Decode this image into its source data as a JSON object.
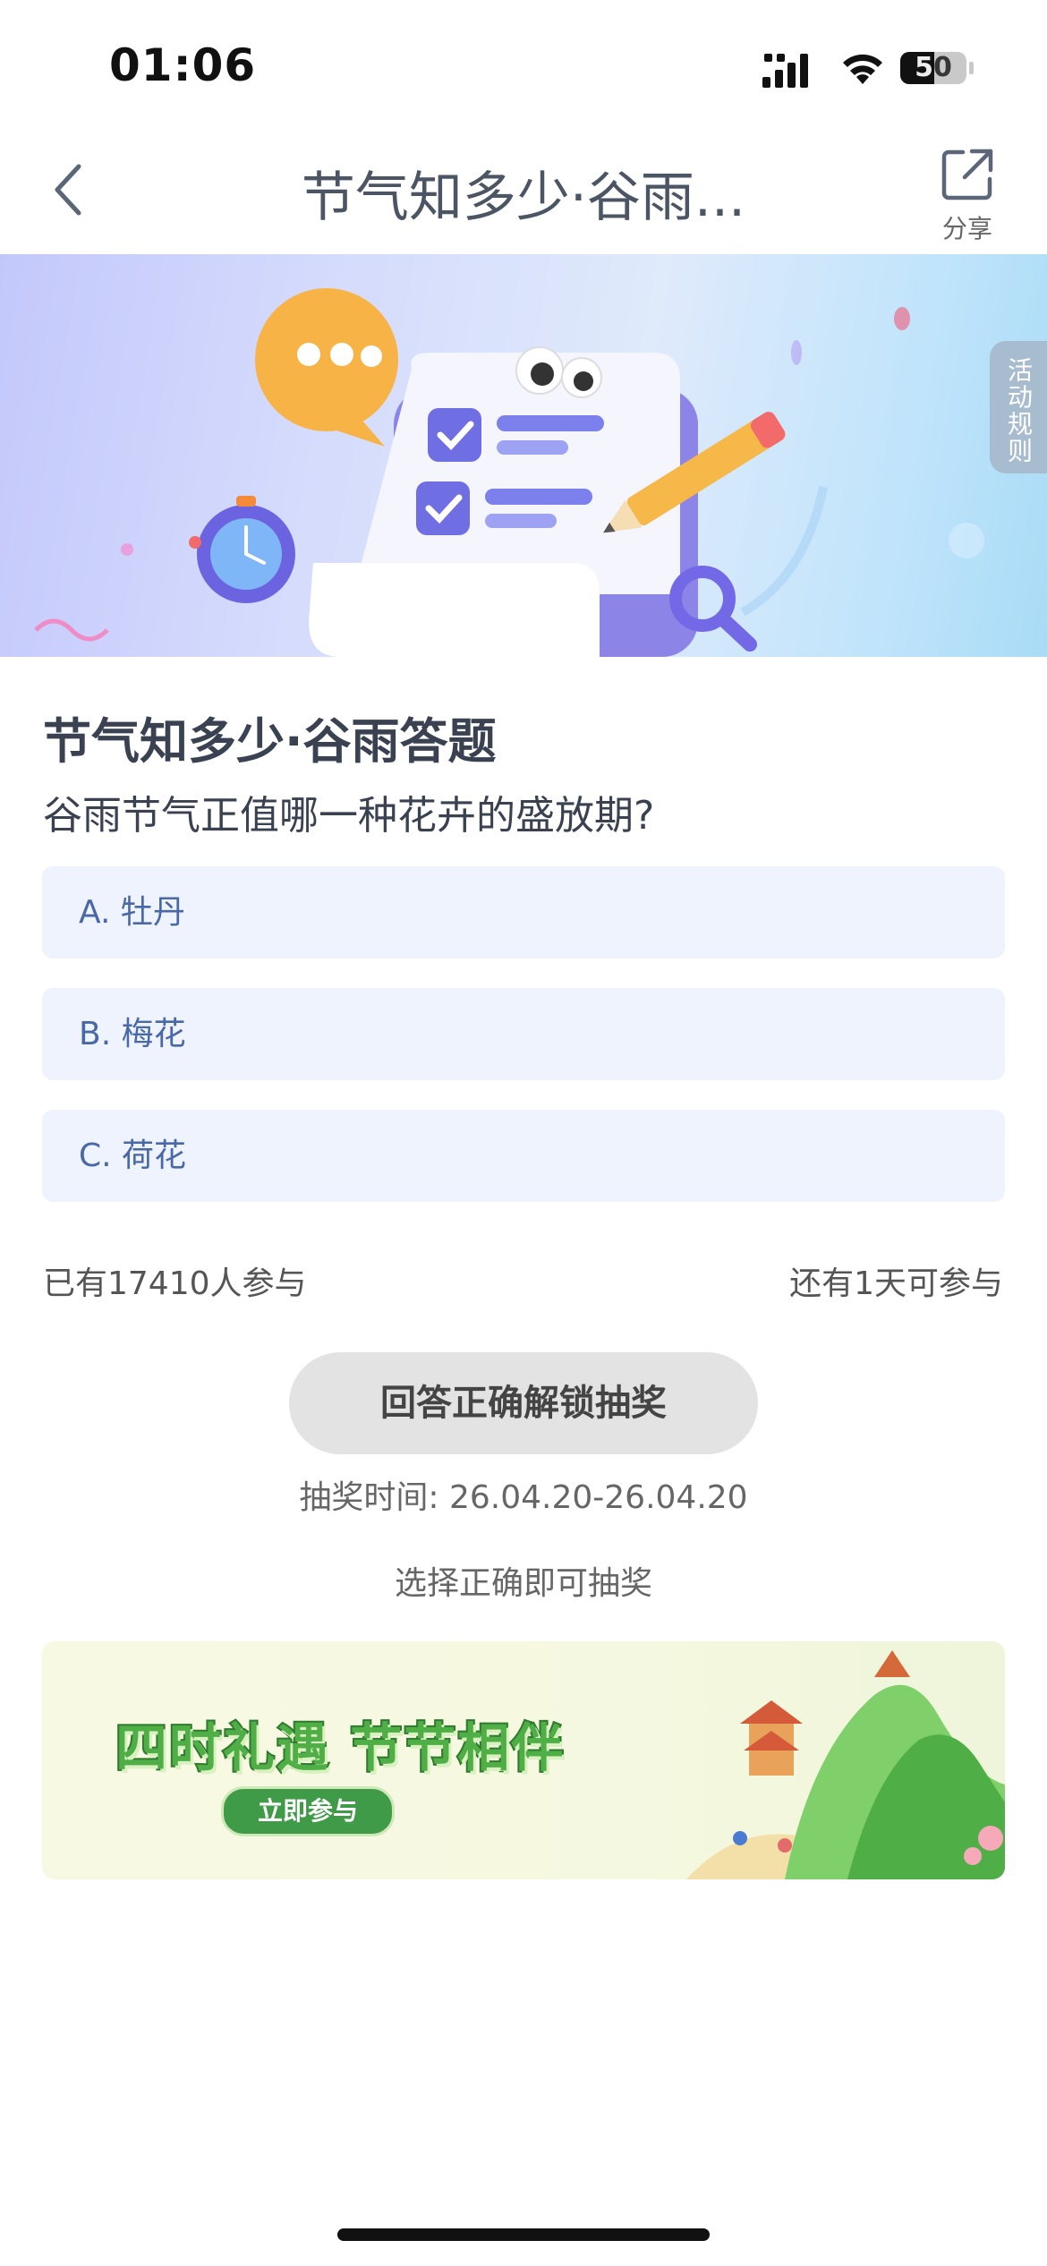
{
  "status_bar": {
    "time": "01:06",
    "battery": "50"
  },
  "nav": {
    "title": "节气知多少·谷雨...",
    "share_label": "分享"
  },
  "banner": {
    "rules_label": "活动规则"
  },
  "quiz": {
    "title": "节气知多少·谷雨答题",
    "question": "谷雨节气正值哪一种花卉的盛放期?",
    "options": [
      {
        "label": "A. 牡丹"
      },
      {
        "label": "B. 梅花"
      },
      {
        "label": "C. 荷花"
      }
    ],
    "participants": "已有17410人参与",
    "remaining": "还有1天可参与",
    "unlock_button": "回答正确解锁抽奖",
    "lottery_time": "抽奖时间: 26.04.20-26.04.20",
    "lottery_hint": "选择正确即可抽奖"
  },
  "promo": {
    "slogan": "四时礼遇 节节相伴",
    "button": "立即参与"
  },
  "colors": {
    "option_bg": "#eef3fd",
    "option_text": "#4868a8",
    "promo_green": "#3f9b48"
  }
}
